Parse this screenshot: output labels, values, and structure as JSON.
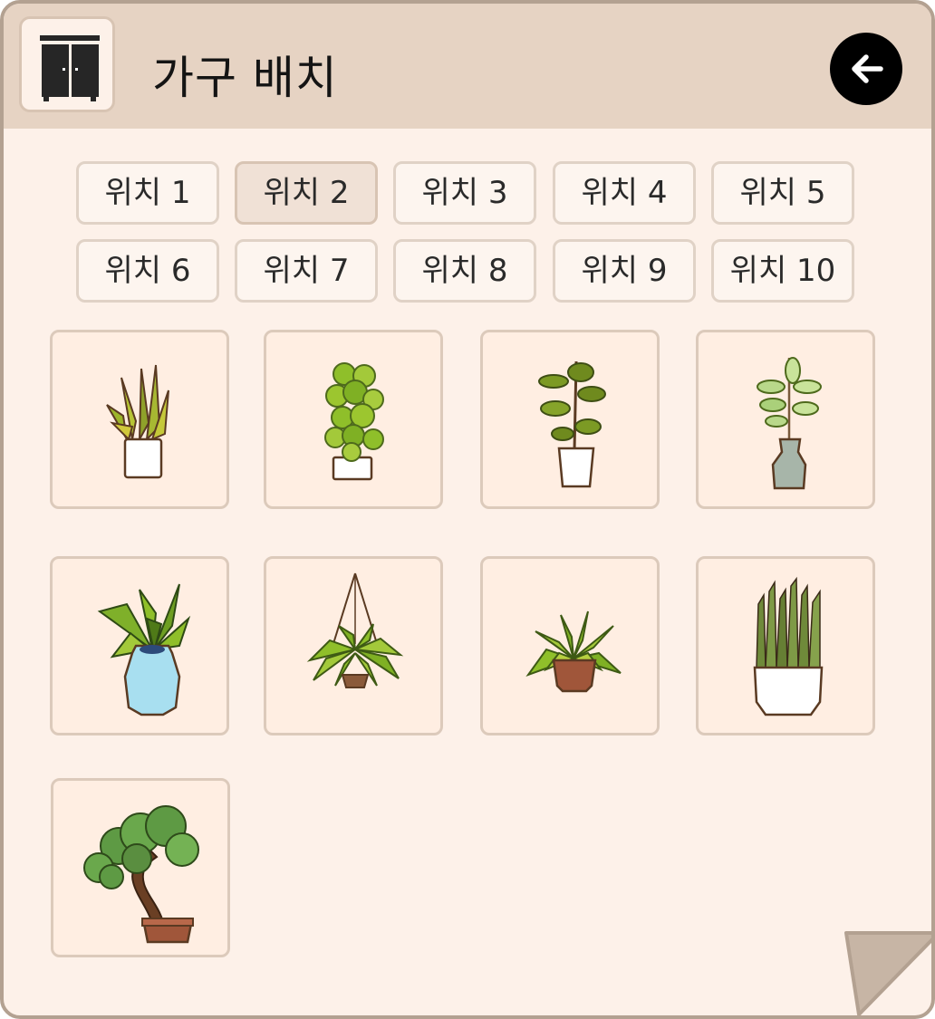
{
  "header": {
    "title": "가구 배치",
    "icon": "wardrobe-icon",
    "back_icon": "arrow-left-icon"
  },
  "tabs": [
    {
      "label": "위치 1",
      "active": false
    },
    {
      "label": "위치 2",
      "active": true
    },
    {
      "label": "위치 3",
      "active": false
    },
    {
      "label": "위치 4",
      "active": false
    },
    {
      "label": "위치 5",
      "active": false
    },
    {
      "label": "위치 6",
      "active": false
    },
    {
      "label": "위치 7",
      "active": false
    },
    {
      "label": "위치 8",
      "active": false
    },
    {
      "label": "위치 9",
      "active": false
    },
    {
      "label": "위치 10",
      "active": false
    }
  ],
  "items": [
    {
      "icon": "snake-plant-white-pot-icon"
    },
    {
      "icon": "bushy-plant-white-pot-icon"
    },
    {
      "icon": "fiddle-leaf-plant-icon"
    },
    {
      "icon": "rubber-plant-vase-icon"
    },
    {
      "icon": "palm-blue-vase-icon"
    },
    {
      "icon": "hanging-fern-icon"
    },
    {
      "icon": "spider-plant-terracotta-icon"
    },
    {
      "icon": "tall-snake-plant-icon"
    },
    {
      "icon": "bonsai-tree-icon"
    }
  ],
  "colors": {
    "panel_bg": "#fdf1e9",
    "header_bg": "#e6d3c3",
    "border": "#b3a191",
    "tile_bg": "#ffeee2",
    "active_tab_bg": "#f0e1d6"
  }
}
